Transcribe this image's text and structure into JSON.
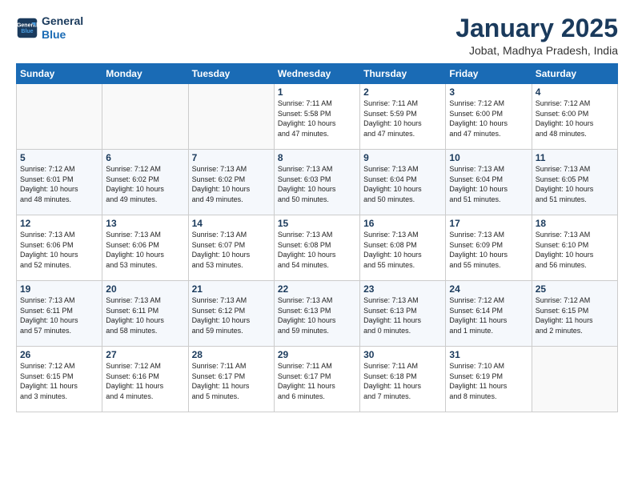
{
  "header": {
    "logo_line1": "General",
    "logo_line2": "Blue",
    "title": "January 2025",
    "subtitle": "Jobat, Madhya Pradesh, India"
  },
  "weekdays": [
    "Sunday",
    "Monday",
    "Tuesday",
    "Wednesday",
    "Thursday",
    "Friday",
    "Saturday"
  ],
  "weeks": [
    [
      {
        "day": "",
        "info": ""
      },
      {
        "day": "",
        "info": ""
      },
      {
        "day": "",
        "info": ""
      },
      {
        "day": "1",
        "info": "Sunrise: 7:11 AM\nSunset: 5:58 PM\nDaylight: 10 hours\nand 47 minutes."
      },
      {
        "day": "2",
        "info": "Sunrise: 7:11 AM\nSunset: 5:59 PM\nDaylight: 10 hours\nand 47 minutes."
      },
      {
        "day": "3",
        "info": "Sunrise: 7:12 AM\nSunset: 6:00 PM\nDaylight: 10 hours\nand 47 minutes."
      },
      {
        "day": "4",
        "info": "Sunrise: 7:12 AM\nSunset: 6:00 PM\nDaylight: 10 hours\nand 48 minutes."
      }
    ],
    [
      {
        "day": "5",
        "info": "Sunrise: 7:12 AM\nSunset: 6:01 PM\nDaylight: 10 hours\nand 48 minutes."
      },
      {
        "day": "6",
        "info": "Sunrise: 7:12 AM\nSunset: 6:02 PM\nDaylight: 10 hours\nand 49 minutes."
      },
      {
        "day": "7",
        "info": "Sunrise: 7:13 AM\nSunset: 6:02 PM\nDaylight: 10 hours\nand 49 minutes."
      },
      {
        "day": "8",
        "info": "Sunrise: 7:13 AM\nSunset: 6:03 PM\nDaylight: 10 hours\nand 50 minutes."
      },
      {
        "day": "9",
        "info": "Sunrise: 7:13 AM\nSunset: 6:04 PM\nDaylight: 10 hours\nand 50 minutes."
      },
      {
        "day": "10",
        "info": "Sunrise: 7:13 AM\nSunset: 6:04 PM\nDaylight: 10 hours\nand 51 minutes."
      },
      {
        "day": "11",
        "info": "Sunrise: 7:13 AM\nSunset: 6:05 PM\nDaylight: 10 hours\nand 51 minutes."
      }
    ],
    [
      {
        "day": "12",
        "info": "Sunrise: 7:13 AM\nSunset: 6:06 PM\nDaylight: 10 hours\nand 52 minutes."
      },
      {
        "day": "13",
        "info": "Sunrise: 7:13 AM\nSunset: 6:06 PM\nDaylight: 10 hours\nand 53 minutes."
      },
      {
        "day": "14",
        "info": "Sunrise: 7:13 AM\nSunset: 6:07 PM\nDaylight: 10 hours\nand 53 minutes."
      },
      {
        "day": "15",
        "info": "Sunrise: 7:13 AM\nSunset: 6:08 PM\nDaylight: 10 hours\nand 54 minutes."
      },
      {
        "day": "16",
        "info": "Sunrise: 7:13 AM\nSunset: 6:08 PM\nDaylight: 10 hours\nand 55 minutes."
      },
      {
        "day": "17",
        "info": "Sunrise: 7:13 AM\nSunset: 6:09 PM\nDaylight: 10 hours\nand 55 minutes."
      },
      {
        "day": "18",
        "info": "Sunrise: 7:13 AM\nSunset: 6:10 PM\nDaylight: 10 hours\nand 56 minutes."
      }
    ],
    [
      {
        "day": "19",
        "info": "Sunrise: 7:13 AM\nSunset: 6:11 PM\nDaylight: 10 hours\nand 57 minutes."
      },
      {
        "day": "20",
        "info": "Sunrise: 7:13 AM\nSunset: 6:11 PM\nDaylight: 10 hours\nand 58 minutes."
      },
      {
        "day": "21",
        "info": "Sunrise: 7:13 AM\nSunset: 6:12 PM\nDaylight: 10 hours\nand 59 minutes."
      },
      {
        "day": "22",
        "info": "Sunrise: 7:13 AM\nSunset: 6:13 PM\nDaylight: 10 hours\nand 59 minutes."
      },
      {
        "day": "23",
        "info": "Sunrise: 7:13 AM\nSunset: 6:13 PM\nDaylight: 11 hours\nand 0 minutes."
      },
      {
        "day": "24",
        "info": "Sunrise: 7:12 AM\nSunset: 6:14 PM\nDaylight: 11 hours\nand 1 minute."
      },
      {
        "day": "25",
        "info": "Sunrise: 7:12 AM\nSunset: 6:15 PM\nDaylight: 11 hours\nand 2 minutes."
      }
    ],
    [
      {
        "day": "26",
        "info": "Sunrise: 7:12 AM\nSunset: 6:15 PM\nDaylight: 11 hours\nand 3 minutes."
      },
      {
        "day": "27",
        "info": "Sunrise: 7:12 AM\nSunset: 6:16 PM\nDaylight: 11 hours\nand 4 minutes."
      },
      {
        "day": "28",
        "info": "Sunrise: 7:11 AM\nSunset: 6:17 PM\nDaylight: 11 hours\nand 5 minutes."
      },
      {
        "day": "29",
        "info": "Sunrise: 7:11 AM\nSunset: 6:17 PM\nDaylight: 11 hours\nand 6 minutes."
      },
      {
        "day": "30",
        "info": "Sunrise: 7:11 AM\nSunset: 6:18 PM\nDaylight: 11 hours\nand 7 minutes."
      },
      {
        "day": "31",
        "info": "Sunrise: 7:10 AM\nSunset: 6:19 PM\nDaylight: 11 hours\nand 8 minutes."
      },
      {
        "day": "",
        "info": ""
      }
    ]
  ]
}
